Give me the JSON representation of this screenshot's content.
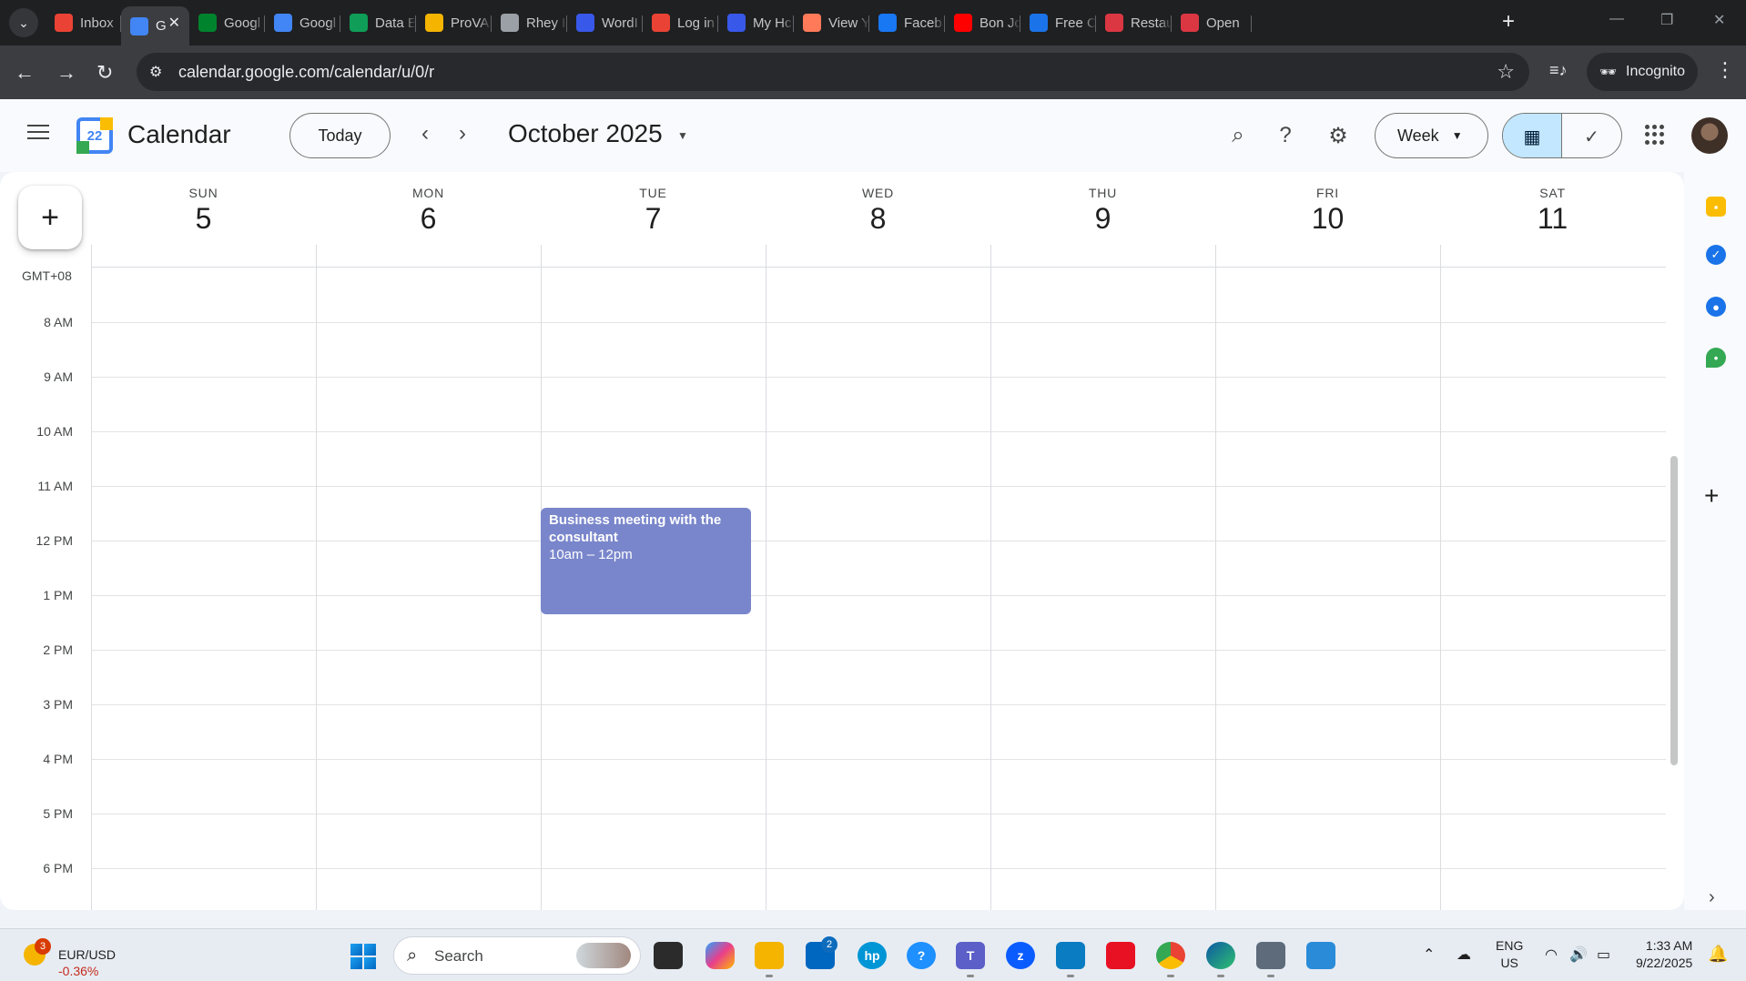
{
  "browser": {
    "tabs": [
      {
        "title": "Inbox",
        "favicon": "gmail-icon",
        "color": "#ea4335"
      },
      {
        "title": "G",
        "favicon": "google-calendar-icon",
        "color": "#4285f4",
        "active": true
      },
      {
        "title": "Googl",
        "favicon": "google-meet-icon",
        "color": "#00832d"
      },
      {
        "title": "Googl",
        "favicon": "google-docs-icon",
        "color": "#4285f4"
      },
      {
        "title": "Data E",
        "favicon": "google-sheets-icon",
        "color": "#0f9d58"
      },
      {
        "title": "ProVA",
        "favicon": "prova-icon",
        "color": "#f4b400"
      },
      {
        "title": "Rhey I",
        "favicon": "globe-icon",
        "color": "#9aa0a6"
      },
      {
        "title": "WordI",
        "favicon": "wordpress-icon",
        "color": "#3858e9"
      },
      {
        "title": "Log in",
        "favicon": "gmail-icon",
        "color": "#ea4335"
      },
      {
        "title": "My Hc",
        "favicon": "wordpress-icon",
        "color": "#3858e9"
      },
      {
        "title": "View Y",
        "favicon": "view-icon",
        "color": "#ff7a59"
      },
      {
        "title": "Faceb",
        "favicon": "facebook-icon",
        "color": "#1877f2"
      },
      {
        "title": "Bon Jc",
        "favicon": "youtube-icon",
        "color": "#ff0000"
      },
      {
        "title": "Free C",
        "favicon": "free-icon",
        "color": "#1a73e8"
      },
      {
        "title": "Restau",
        "favicon": "opentable-icon",
        "color": "#da3743"
      },
      {
        "title": "Open",
        "favicon": "opentable-icon",
        "color": "#da3743"
      }
    ],
    "url": "calendar.google.com/calendar/u/0/r",
    "incognito_label": "Incognito"
  },
  "header": {
    "app_name": "Calendar",
    "logo_day": "22",
    "today_label": "Today",
    "month_label": "October 2025",
    "view_label": "Week"
  },
  "week": {
    "days": [
      {
        "dow": "SUN",
        "num": "5"
      },
      {
        "dow": "MON",
        "num": "6"
      },
      {
        "dow": "TUE",
        "num": "7"
      },
      {
        "dow": "WED",
        "num": "8"
      },
      {
        "dow": "THU",
        "num": "9"
      },
      {
        "dow": "FRI",
        "num": "10"
      },
      {
        "dow": "SAT",
        "num": "11"
      }
    ],
    "timezone": "GMT+08",
    "hours": [
      "8 AM",
      "9 AM",
      "10 AM",
      "11 AM",
      "12 PM",
      "1 PM",
      "2 PM",
      "3 PM",
      "4 PM",
      "5 PM",
      "6 PM"
    ]
  },
  "event": {
    "title": "Business meeting with the consultant",
    "time": "10am – 12pm",
    "color": "#7986cb"
  },
  "side_panel": {
    "icons": [
      "keep-icon",
      "tasks-icon",
      "contacts-icon",
      "maps-icon"
    ]
  },
  "taskbar": {
    "ticker_symbol": "EUR/USD",
    "ticker_change": "-0.36%",
    "ticker_badge": "3",
    "search_placeholder": "Search",
    "store_badge": "2",
    "lang_line1": "ENG",
    "lang_line2": "US",
    "time": "1:33 AM",
    "date": "9/22/2025"
  }
}
